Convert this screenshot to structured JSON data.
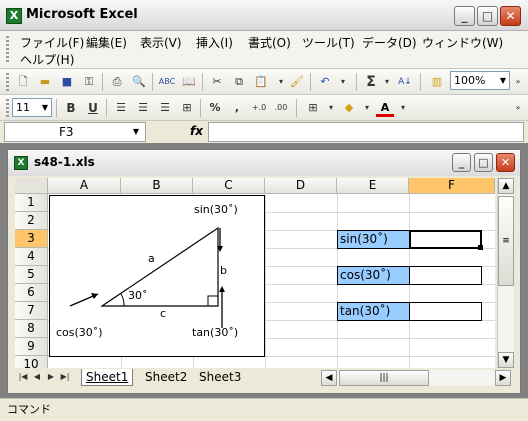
{
  "app": {
    "title": "Microsoft Excel",
    "icon": "excel-icon"
  },
  "window_buttons": {
    "minimize": "_",
    "maximize": "□",
    "close": "✕"
  },
  "menu": {
    "items": [
      "ファイル(F)",
      "編集(E)",
      "表示(V)",
      "挿入(I)",
      "書式(O)",
      "ツール(T)",
      "データ(D)",
      "ウィンドウ(W)",
      "ヘルプ(H)"
    ]
  },
  "toolbar": {
    "zoom": "100%",
    "font_size": "11",
    "bold": "B",
    "underline": "U",
    "percent": "%",
    "comma": ","
  },
  "formula_bar": {
    "name_box": "F3",
    "fx": "fx",
    "formula": ""
  },
  "workbook": {
    "name": "s48-1.xls",
    "icon": "excel-doc-icon"
  },
  "grid": {
    "columns": [
      "A",
      "B",
      "C",
      "D",
      "E",
      "F"
    ],
    "selected_column": "F",
    "rows": [
      "1",
      "2",
      "3",
      "4",
      "5",
      "6",
      "7",
      "8",
      "9",
      "10"
    ],
    "selected_row": "3",
    "labels": {
      "e3": "sin(30˚)",
      "e5": "cos(30˚)",
      "e7": "tan(30˚)"
    }
  },
  "diagram": {
    "sin_label": "sin(30˚)",
    "a_label": "a",
    "b_label": "b",
    "c_label": "c",
    "angle_label": "30˚",
    "cos_label": "cos(30˚)",
    "tan_label": "tan(30˚)"
  },
  "sheets": {
    "tabs": [
      "Sheet1",
      "Sheet2",
      "Sheet3"
    ],
    "active": "Sheet1"
  },
  "status": {
    "text": "コマンド"
  }
}
